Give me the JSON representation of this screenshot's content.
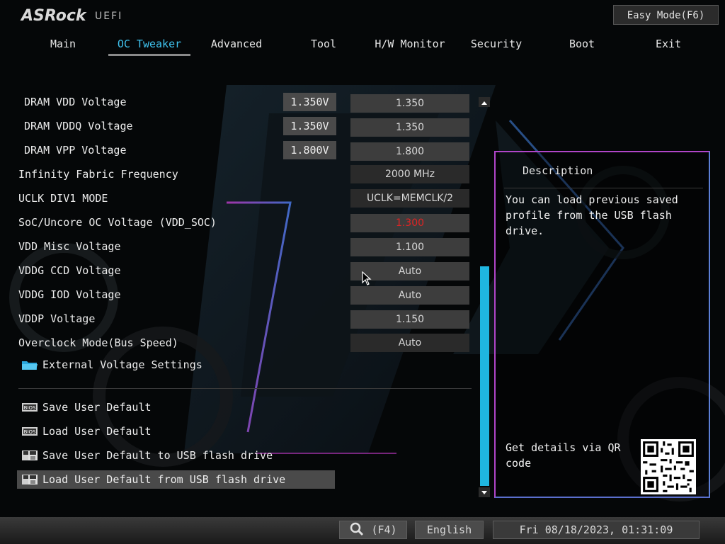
{
  "header": {
    "logo": "ASRock",
    "logo_sub": "UEFI",
    "easy_mode_label": "Easy Mode(F6)"
  },
  "tabs": [
    {
      "label": "Main",
      "active": false
    },
    {
      "label": "OC Tweaker",
      "active": true
    },
    {
      "label": "Advanced",
      "active": false
    },
    {
      "label": "Tool",
      "active": false
    },
    {
      "label": "H/W Monitor",
      "active": false
    },
    {
      "label": "Security",
      "active": false
    },
    {
      "label": "Boot",
      "active": false
    },
    {
      "label": "Exit",
      "active": false
    }
  ],
  "settings": [
    {
      "label": "DRAM VDD Voltage",
      "current": "1.350V",
      "value": "1.350"
    },
    {
      "label": "DRAM VDDQ Voltage",
      "current": "1.350V",
      "value": "1.350"
    },
    {
      "label": "DRAM VPP Voltage",
      "current": "1.800V",
      "value": "1.800"
    },
    {
      "label": "Infinity Fabric Frequency",
      "value": "2000 MHz"
    },
    {
      "label": "UCLK DIV1 MODE",
      "value": "UCLK=MEMCLK/2"
    },
    {
      "label": "SoC/Uncore OC Voltage (VDD_SOC)",
      "value": "1.300",
      "value_color": "#e02424"
    },
    {
      "label": "VDD Misc Voltage",
      "value": "1.100"
    },
    {
      "label": "VDDG CCD Voltage",
      "value": "Auto"
    },
    {
      "label": "VDDG IOD Voltage",
      "value": "Auto"
    },
    {
      "label": "VDDP Voltage",
      "value": "1.150"
    },
    {
      "label": "Overclock Mode(Bus Speed)",
      "value": "Auto"
    }
  ],
  "submenu": {
    "label": "External Voltage Settings",
    "icon": "folder-icon"
  },
  "actions": [
    {
      "label": "Save User Default",
      "icon": "bios-chip-icon"
    },
    {
      "label": "Load User Default",
      "icon": "bios-chip-icon"
    },
    {
      "label": "Save User Default to USB flash drive",
      "icon": "floppy-disk-icon"
    },
    {
      "label": "Load User Default from USB flash drive",
      "icon": "floppy-disk-icon",
      "selected": true
    }
  ],
  "description": {
    "title": "Description",
    "text": "You can load previous saved profile from the USB flash drive.",
    "qr_text": "Get details via QR code"
  },
  "footer": {
    "search_label": "(F4)",
    "language": "English",
    "datetime": "Fri 08/18/2023, 01:31:09"
  },
  "colors": {
    "accent": "#3fc3ef",
    "scrollbar": "#1fb6e0",
    "warning_value": "#e02424",
    "panel_border": "#b045c8"
  }
}
